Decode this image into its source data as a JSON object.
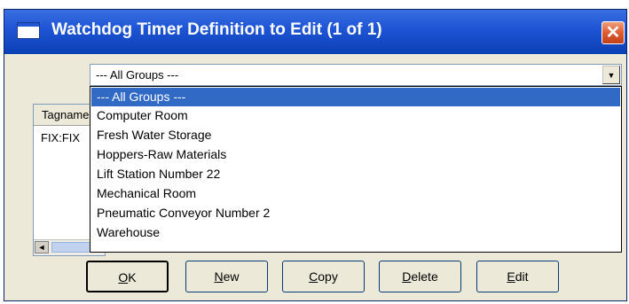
{
  "window": {
    "title": "Watchdog Timer Definition to Edit (1 of 1)",
    "close_glyph": "✕"
  },
  "group_filter": {
    "selected": "--- All Groups ---",
    "options": [
      "--- All Groups ---",
      "Computer Room",
      "Fresh Water Storage",
      "Hoppers-Raw Materials",
      "Lift Station Number 22",
      "Mechanical Room",
      "Pneumatic Conveyor Number 2",
      "Warehouse"
    ],
    "arrow_glyph": "▼"
  },
  "table": {
    "column_header": "Tagname",
    "rows": [
      "FIX:FIX"
    ],
    "scroll_left_glyph": "◄"
  },
  "buttons": {
    "ok": {
      "mnemonic": "O",
      "rest": "K"
    },
    "new": {
      "mnemonic": "N",
      "rest": "ew"
    },
    "copy": {
      "mnemonic": "C",
      "rest": "opy"
    },
    "delete": {
      "mnemonic": "D",
      "rest": "elete"
    },
    "edit": {
      "mnemonic": "E",
      "rest": "dit"
    }
  },
  "colors": {
    "title_bar": "#1f56d6",
    "selection": "#316ac5",
    "dialog_bg": "#ece9d8"
  },
  "icons": {
    "title": "window-icon",
    "close": "close-icon",
    "dropdown": "chevron-down-icon",
    "scroll_left": "arrow-left-icon"
  }
}
